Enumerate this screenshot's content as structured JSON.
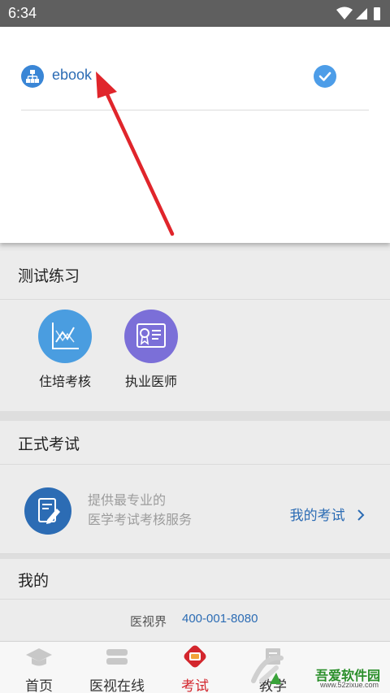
{
  "status_bar": {
    "time": "6:34"
  },
  "dropdown": {
    "selected_item": {
      "label": "ebook",
      "icon": "org-chart-icon",
      "checked": true
    }
  },
  "practice_section": {
    "title": "测试练习",
    "items": [
      {
        "label": "住培考核",
        "icon": "line-chart-icon",
        "color": "#4a9de0"
      },
      {
        "label": "执业医师",
        "icon": "certificate-icon",
        "color": "#7b6fd8"
      }
    ]
  },
  "exam_section": {
    "title": "正式考试",
    "description_line1": "提供最专业的",
    "description_line2": "医学考试考核服务",
    "link_label": "我的考试"
  },
  "mine_section": {
    "title": "我的",
    "contact_label": "医视界",
    "phone": "400-001-8080"
  },
  "tab_bar": {
    "items": [
      {
        "label": "首页",
        "icon": "graduation-cap-icon",
        "active": false
      },
      {
        "label": "医视在线",
        "icon": "layers-icon",
        "active": false
      },
      {
        "label": "考试",
        "icon": "exam-badge-icon",
        "active": true
      },
      {
        "label": "教学",
        "icon": "book-icon",
        "active": false
      }
    ]
  },
  "watermark": {
    "text": "吾爱软件园",
    "url": "www.52zixue.com"
  },
  "colors": {
    "accent_blue": "#2c6cb4",
    "active_red": "#d3262d",
    "annotation_arrow": "#e0252b"
  }
}
